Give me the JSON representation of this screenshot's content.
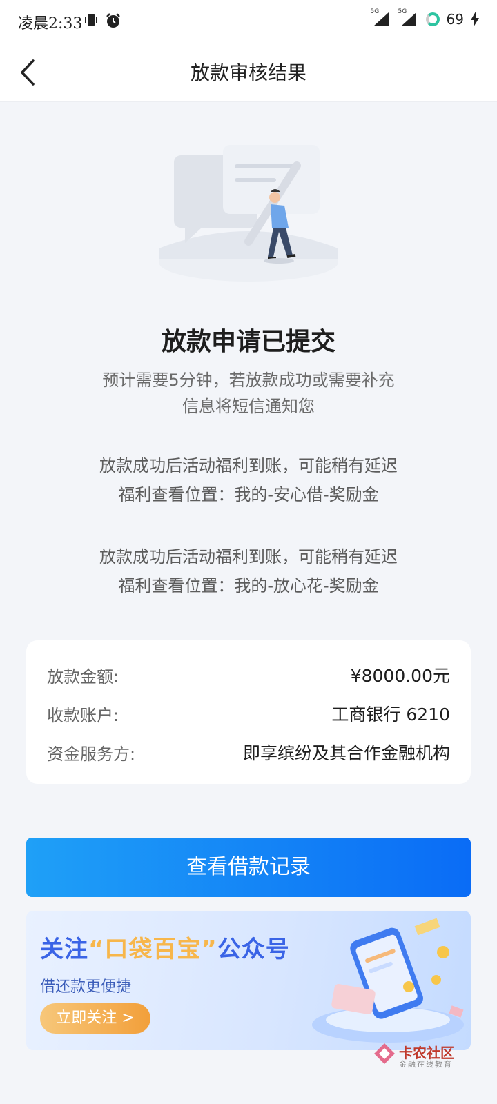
{
  "status_bar": {
    "time": "凌晨2:33",
    "signal_1_label": "5G",
    "signal_2_label": "5G",
    "battery": "69"
  },
  "header": {
    "title": "放款审核结果",
    "back_icon": "back-arrow-icon"
  },
  "result": {
    "title": "放款申请已提交",
    "desc_line1": "预计需要5分钟，若放款成功或需要补充",
    "desc_line2": "信息将短信通知您"
  },
  "notes": [
    {
      "line1": "放款成功后活动福利到账，可能稍有延迟",
      "line2": "福利查看位置：我的-安心借-奖励金"
    },
    {
      "line1": "放款成功后活动福利到账，可能稍有延迟",
      "line2": "福利查看位置：我的-放心花-奖励金"
    }
  ],
  "info": {
    "rows": [
      {
        "label": "放款金额:",
        "value": "¥8000.00元"
      },
      {
        "label": "收款账户:",
        "value": "工商银行 6210"
      },
      {
        "label": "资金服务方:",
        "value": "即享缤纷及其合作金融机构"
      }
    ]
  },
  "actions": {
    "primary_label": "查看借款记录"
  },
  "banner": {
    "title_prefix": "关注",
    "title_highlight": "“口袋百宝”",
    "title_suffix": "公众号",
    "subtitle": "借还款更便捷",
    "cta_label": "立即关注 >"
  },
  "watermark": {
    "brand": "卡农社区",
    "tagline": "金融在线教育"
  },
  "colors": {
    "primary_start": "#1fa0f7",
    "primary_end": "#0a6cf6",
    "banner_title": "#3a64e6",
    "banner_highlight": "#f7b64b"
  }
}
